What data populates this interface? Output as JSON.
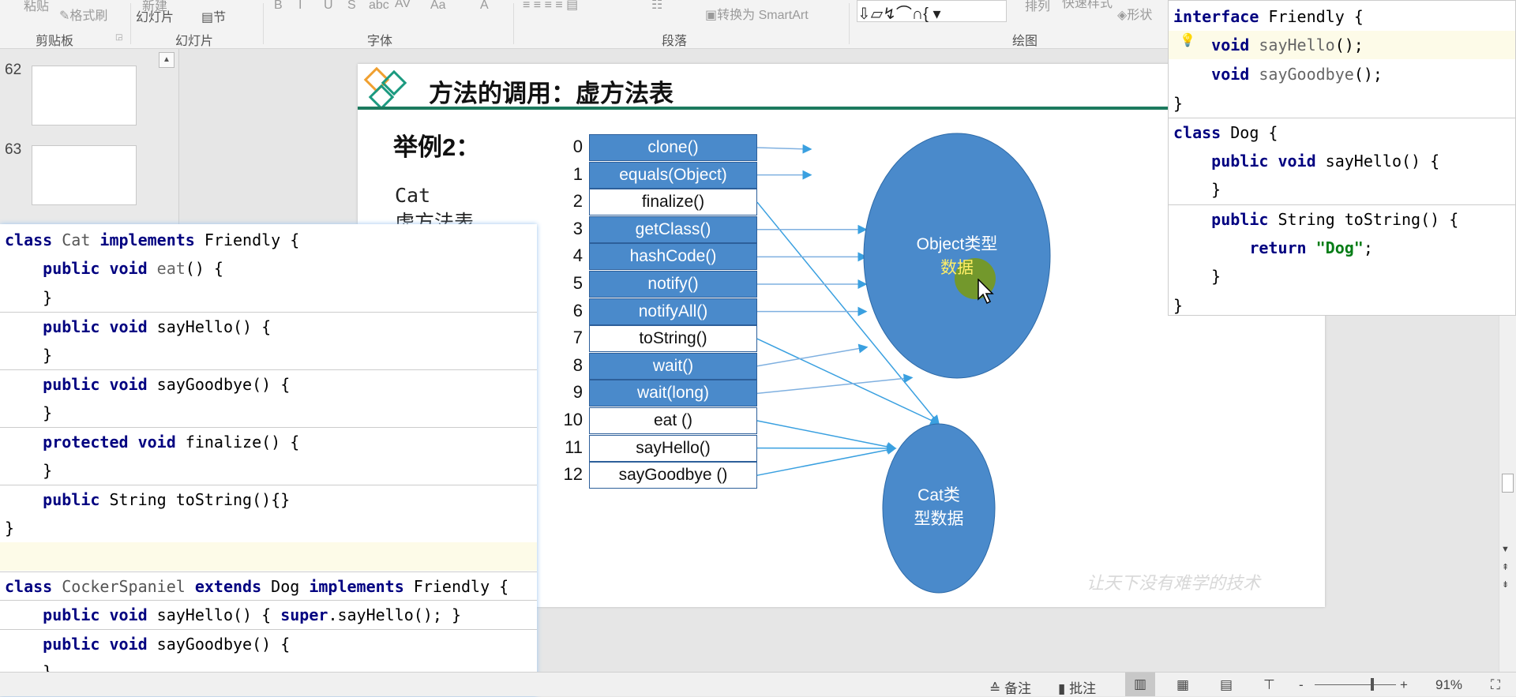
{
  "ribbon": {
    "items": [
      "粘贴",
      "格式刷",
      "新建",
      "幻灯片",
      "节",
      "B",
      "I",
      "U",
      "S",
      "abc",
      "AV",
      "Aa",
      "A",
      "转换为 SmartArt",
      "排列",
      "快速样式",
      "形状"
    ],
    "groups": [
      "剪贴板",
      "幻灯片",
      "字体",
      "段落",
      "绘图"
    ]
  },
  "thumbnails": [
    {
      "number": "62"
    },
    {
      "number": "63"
    }
  ],
  "slide": {
    "title": "方法的调用：虚方法表",
    "example": "举例2：",
    "cat_label": "Cat",
    "cat_sub": "虚方法表",
    "table": [
      {
        "i": "0",
        "m": "clone()",
        "t": "object"
      },
      {
        "i": "1",
        "m": "equals(Object)",
        "t": "object"
      },
      {
        "i": "2",
        "m": "finalize()",
        "t": "cat"
      },
      {
        "i": "3",
        "m": "getClass()",
        "t": "object"
      },
      {
        "i": "4",
        "m": "hashCode()",
        "t": "object"
      },
      {
        "i": "5",
        "m": "notify()",
        "t": "object"
      },
      {
        "i": "6",
        "m": "notifyAll()",
        "t": "object"
      },
      {
        "i": "7",
        "m": "toString()",
        "t": "cat"
      },
      {
        "i": "8",
        "m": "wait()",
        "t": "object"
      },
      {
        "i": "9",
        "m": "wait(long)",
        "t": "object"
      },
      {
        "i": "10",
        "m": "eat ()",
        "t": "cat"
      },
      {
        "i": "11",
        "m": "sayHello()",
        "t": "cat"
      },
      {
        "i": "12",
        "m": "sayGoodbye ()",
        "t": "cat"
      }
    ],
    "object_ellipse_a": "Object类型",
    "object_ellipse_b": "数据",
    "cat_ellipse_a": "Cat类",
    "cat_ellipse_b": "型数据",
    "watermark": "让天下没有难学的技术",
    "colors": {
      "blue": "#4a8acb",
      "ellipse": "#4a8acb",
      "title_line": "#1c7a5e"
    }
  },
  "code_right": [
    [
      [
        "kw",
        "interface "
      ],
      [
        "",
        "Friendly {"
      ]
    ],
    [
      [
        "",
        "    "
      ],
      [
        "kw",
        "void "
      ],
      [
        "fn",
        "sayHello"
      ],
      [
        "",
        "();"
      ]
    ],
    [
      [
        "",
        "    "
      ],
      [
        "kw",
        "void "
      ],
      [
        "fn",
        "sayGoodbye"
      ],
      [
        "",
        "();"
      ]
    ],
    [
      [
        "",
        "}"
      ]
    ],
    [
      [
        "kw",
        "class "
      ],
      [
        "",
        "Dog {"
      ]
    ],
    [
      [
        "",
        "    "
      ],
      [
        "kw",
        "public void "
      ],
      [
        "",
        "sayHello() {"
      ]
    ],
    [
      [
        "",
        "    }"
      ]
    ],
    [
      [
        "",
        "    "
      ],
      [
        "kw",
        "public "
      ],
      [
        "",
        "String toString() {"
      ]
    ],
    [
      [
        "",
        "        "
      ],
      [
        "kw",
        "return "
      ],
      [
        "st",
        "\"Dog\""
      ],
      [
        "",
        ";"
      ]
    ],
    [
      [
        "",
        "    }"
      ]
    ],
    [
      [
        "",
        "}"
      ]
    ]
  ],
  "code_left": [
    [
      [
        "kw",
        "class "
      ],
      [
        "cn",
        "Cat "
      ],
      [
        "kw",
        "implements "
      ],
      [
        "",
        "Friendly {"
      ]
    ],
    [
      [
        "",
        "    "
      ],
      [
        "kw",
        "public void "
      ],
      [
        "fn",
        "eat"
      ],
      [
        "",
        "() {"
      ]
    ],
    [
      [
        "",
        "    }"
      ]
    ],
    [
      [
        "",
        "    "
      ],
      [
        "kw",
        "public void "
      ],
      [
        "",
        "sayHello() {"
      ]
    ],
    [
      [
        "",
        "    }"
      ]
    ],
    [
      [
        "",
        "    "
      ],
      [
        "kw",
        "public void "
      ],
      [
        "",
        "sayGoodbye() {"
      ]
    ],
    [
      [
        "",
        "    }"
      ]
    ],
    [
      [
        "",
        "    "
      ],
      [
        "kw",
        "protected void "
      ],
      [
        "",
        "finalize() {"
      ]
    ],
    [
      [
        "",
        "    }"
      ]
    ],
    [
      [
        "",
        "    "
      ],
      [
        "kw",
        "public "
      ],
      [
        "",
        "String toString(){}"
      ]
    ],
    [
      [
        "",
        "}"
      ]
    ],
    [
      [
        "",
        ""
      ]
    ],
    [
      [
        "kw",
        "class "
      ],
      [
        "cn",
        "CockerSpaniel "
      ],
      [
        "kw",
        "extends "
      ],
      [
        "",
        "Dog "
      ],
      [
        "kw",
        "implements "
      ],
      [
        "",
        "Friendly {"
      ]
    ],
    [
      [
        "",
        "    "
      ],
      [
        "kw",
        "public void "
      ],
      [
        "",
        "sayHello() { "
      ],
      [
        "kw",
        "super"
      ],
      [
        "",
        ".sayHello(); }"
      ]
    ],
    [
      [
        "",
        "    "
      ],
      [
        "kw",
        "public void "
      ],
      [
        "",
        "sayGoodbye() {"
      ]
    ],
    [
      [
        "",
        "    }"
      ]
    ]
  ],
  "status": {
    "notes": "备注",
    "comments": "批注",
    "zoom": "91%",
    "zoom_level": 91
  }
}
